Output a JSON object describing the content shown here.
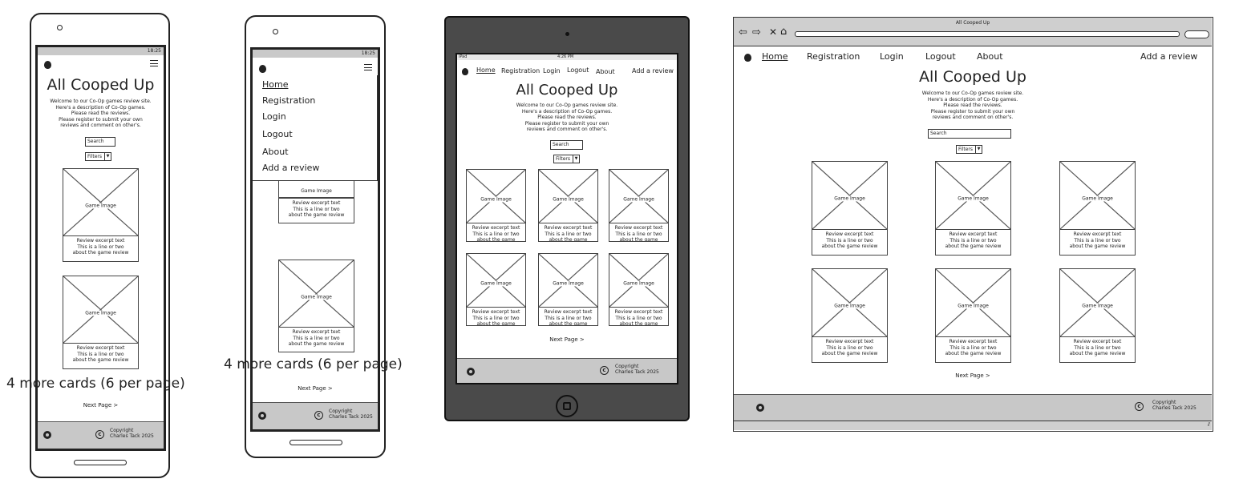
{
  "site": {
    "title": "All Cooped Up",
    "intro": [
      "Welcome to our Co-Op games review site.",
      "Here's a description of Co-Op games.",
      "Please read the reviews.",
      "Please register to submit your own",
      "reviews and comment on other's."
    ],
    "search_label": "Search",
    "filter_label": "Filters",
    "nav": [
      "Home",
      "Registration",
      "Login",
      "Logout",
      "About"
    ],
    "add_review": "Add a review",
    "card": {
      "image_label": "Game Image",
      "excerpt": [
        "Review excerpt text",
        "This is a line or two",
        "about the game review"
      ],
      "excerpt_truncated": [
        "Review excerpt text",
        "This is a line or two",
        "about the game"
      ]
    },
    "next_page": "Next Page",
    "copyright": [
      "Copyright",
      "Charles Tack 2025"
    ]
  },
  "phone_status_time": "18:25",
  "annotation": "4 more cards (6 per page)",
  "tablet_status": {
    "left": "iPad",
    "time": "4:26 PM"
  },
  "browser_title": "All Cooped Up"
}
